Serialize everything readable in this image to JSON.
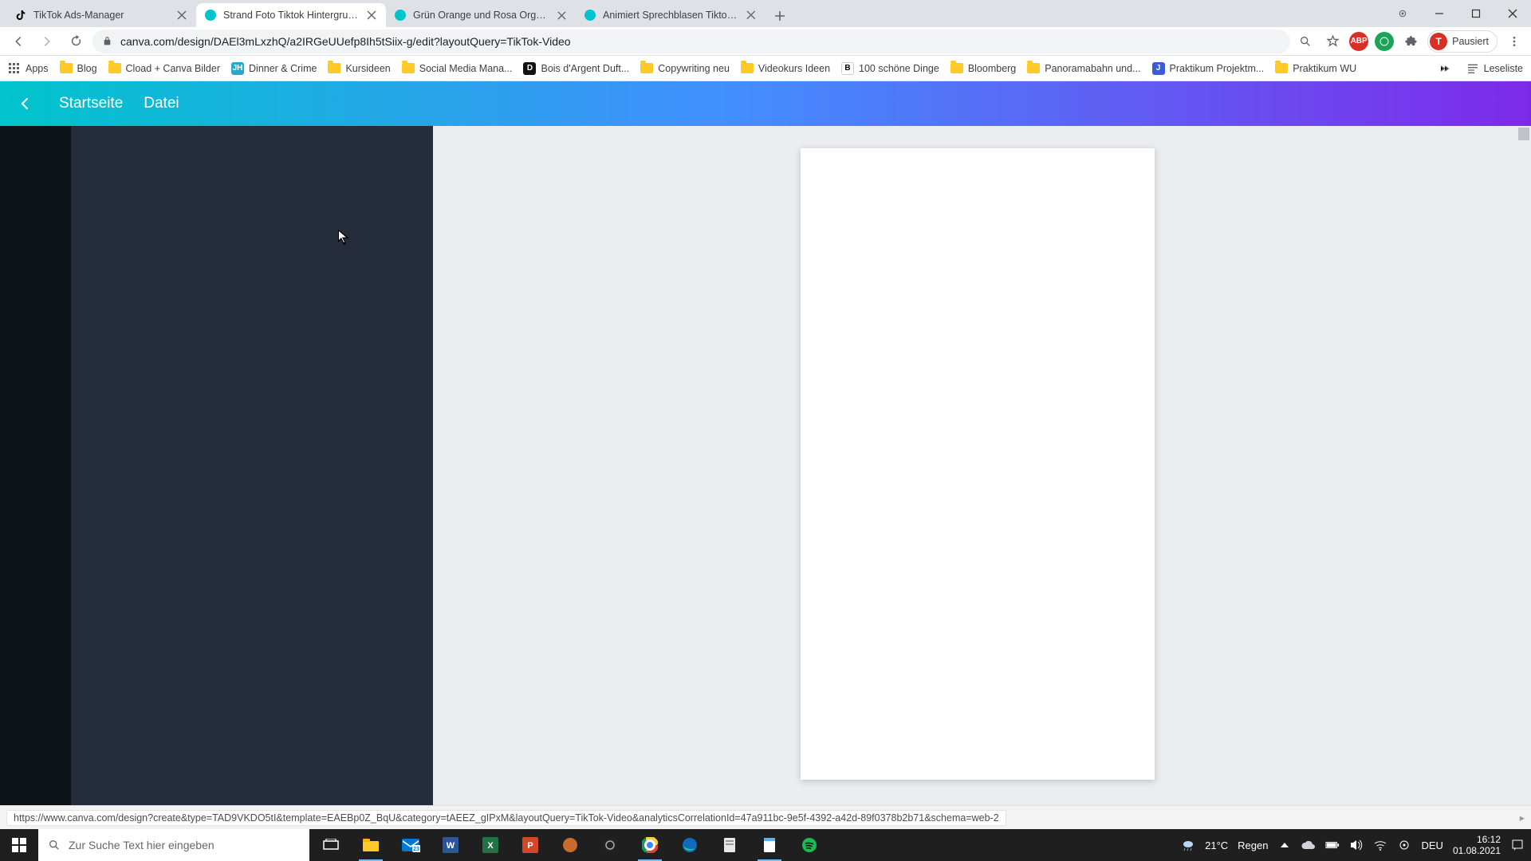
{
  "browser": {
    "tabs": [
      {
        "title": "TikTok Ads-Manager",
        "favicon": "tiktok"
      },
      {
        "title": "Strand Foto Tiktok Hintergrund",
        "favicon": "canva",
        "active": true
      },
      {
        "title": "Grün Orange und Rosa Organisc",
        "favicon": "canva"
      },
      {
        "title": "Animiert Sprechblasen Tiktok-H",
        "favicon": "canva"
      }
    ],
    "url": "canva.com/design/DAEl3mLxzhQ/a2IRGeUUefp8Ih5tSiix-g/edit?layoutQuery=TikTok-Video",
    "profile_label": "Pausiert",
    "profile_initial": "T",
    "bookmarks": [
      {
        "label": "Apps",
        "icon": "apps"
      },
      {
        "label": "Blog",
        "icon": "folder"
      },
      {
        "label": "Cload + Canva Bilder",
        "icon": "folder"
      },
      {
        "label": "Dinner & Crime",
        "icon": "dc"
      },
      {
        "label": "Kursideen",
        "icon": "folder"
      },
      {
        "label": "Social Media Mana...",
        "icon": "folder"
      },
      {
        "label": "Bois d'Argent Duft...",
        "icon": "bd"
      },
      {
        "label": "Copywriting neu",
        "icon": "folder"
      },
      {
        "label": "Videokurs Ideen",
        "icon": "folder"
      },
      {
        "label": "100 schöne Dinge",
        "icon": "b"
      },
      {
        "label": "Bloomberg",
        "icon": "folder"
      },
      {
        "label": "Panoramabahn und...",
        "icon": "folder"
      },
      {
        "label": "Praktikum Projektm...",
        "icon": "pj"
      },
      {
        "label": "Praktikum WU",
        "icon": "folder"
      }
    ],
    "reading_list_label": "Leseliste",
    "status_url": "https://www.canva.com/design?create&type=TAD9VKDO5tI&template=EAEBp0Z_BqU&category=tAEEZ_gIPxM&layoutQuery=TikTok-Video&analyticsCorrelationId=47a911bc-9e5f-4392-a42d-89f0378b2b71&schema=web-2"
  },
  "app": {
    "menu_home": "Startseite",
    "menu_file": "Datei"
  },
  "taskbar": {
    "search_placeholder": "Zur Suche Text hier eingeben",
    "weather_temp": "21°C",
    "weather_label": "Regen",
    "lang": "DEU",
    "time": "16:12",
    "date": "01.08.2021"
  }
}
